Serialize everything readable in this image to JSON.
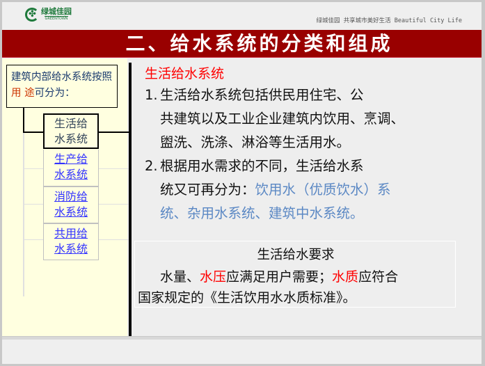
{
  "header": {
    "logo_cn": "绿城佳园",
    "logo_en": "GREENTOWN",
    "tagline": "绿城佳园  共享城市美好生活  Beautiful City Life"
  },
  "title": "二、给水系统的分类和组成",
  "left_panel": {
    "intro_part1": "建筑内部给水系统按照",
    "intro_red1": "用",
    "intro_red2": "途",
    "intro_part2": "可分为：",
    "nodes": [
      {
        "line1": "生活给",
        "line2": "水系统",
        "active": true
      },
      {
        "line1": "生产给",
        "line2": "水系统",
        "active": false
      },
      {
        "line1": "消防给",
        "line2": "水系统",
        "active": false
      },
      {
        "line1": "共用给",
        "line2": "水系统",
        "active": false
      }
    ]
  },
  "content": {
    "section_title": "生活给水系统",
    "item1_num": "1.",
    "item1_line1": "生活给水系统包括供民用住宅、公",
    "item1_line2": "共建筑以及工业企业建筑内饮用、烹调、",
    "item1_line3": "盥洗、洗涤、淋浴等生活用水。",
    "item2_num": "2.",
    "item2_line1": "根据用水需求的不同，生活给水系",
    "item2_line2_black": "统又可再分为：",
    "item2_line2_blue": "饮用水（优质饮水）系",
    "item2_line3_blue": "统、杂用水系统、建筑中水系统。"
  },
  "requirements": {
    "title": "生活给水要求",
    "seg1": "水量、",
    "seg2_red": "水压",
    "seg3": "应满足用户需要；",
    "seg4_red": "水质",
    "seg5": "应符合",
    "line2": "国家规定的《生活饮用水水质标准》。"
  },
  "colors": {
    "title_bar": "#990000",
    "left_panel_bg": "#ffffe0",
    "accent_red": "#ff0000",
    "link_blue": "#3333ff",
    "sub_blue": "#5b88c4",
    "brand_green": "#1f7a3c"
  }
}
